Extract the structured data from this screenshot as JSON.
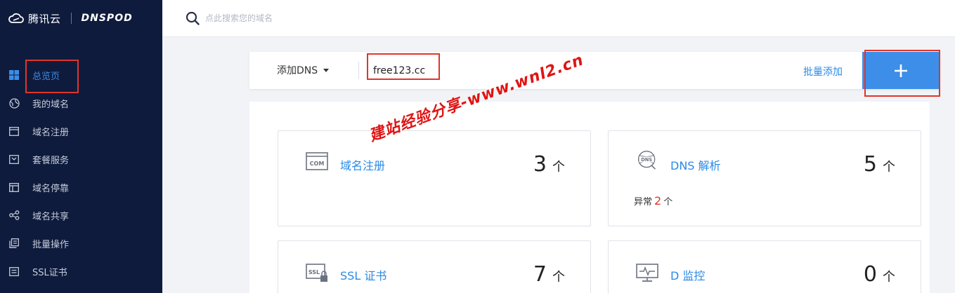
{
  "brand": {
    "name": "腾讯云",
    "product": "DNSPOD"
  },
  "sidebar": {
    "items": [
      {
        "label": "总览页",
        "icon": "grid-icon",
        "active": true
      },
      {
        "label": "我的域名",
        "icon": "globe-icon"
      },
      {
        "label": "域名注册",
        "icon": "browser-icon"
      },
      {
        "label": "套餐服务",
        "icon": "package-icon"
      },
      {
        "label": "域名停靠",
        "icon": "layout-icon"
      },
      {
        "label": "域名共享",
        "icon": "share-icon"
      },
      {
        "label": "批量操作",
        "icon": "copy-icon"
      },
      {
        "label": "SSL证书",
        "icon": "certificate-icon"
      }
    ]
  },
  "search": {
    "placeholder": "点此搜索您的域名"
  },
  "addbar": {
    "dropdown_label": "添加DNS",
    "domain_value": "free123.cc",
    "batch_label": "批量添加",
    "plus_label": "+"
  },
  "cards": {
    "domain_reg": {
      "title": "域名注册",
      "count": "3",
      "unit": "个",
      "icon": "com-icon"
    },
    "dns": {
      "title": "DNS 解析",
      "count": "5",
      "unit": "个",
      "icon": "dns-globe-icon",
      "sub_label": "异常",
      "sub_count": "2",
      "sub_unit": "个"
    },
    "ssl": {
      "title": "SSL 证书",
      "count": "7",
      "unit": "个",
      "icon": "ssl-lock-icon"
    },
    "monitor": {
      "title": "D 监控",
      "count": "0",
      "unit": "个",
      "icon": "monitor-icon"
    }
  },
  "watermark": "建站经验分享-www.wnl2.cn",
  "colors": {
    "sidebar_bg": "#0f1b3d",
    "accent": "#2a8ae5",
    "plus_bg": "#3d8ee9",
    "highlight": "#e0352b"
  }
}
